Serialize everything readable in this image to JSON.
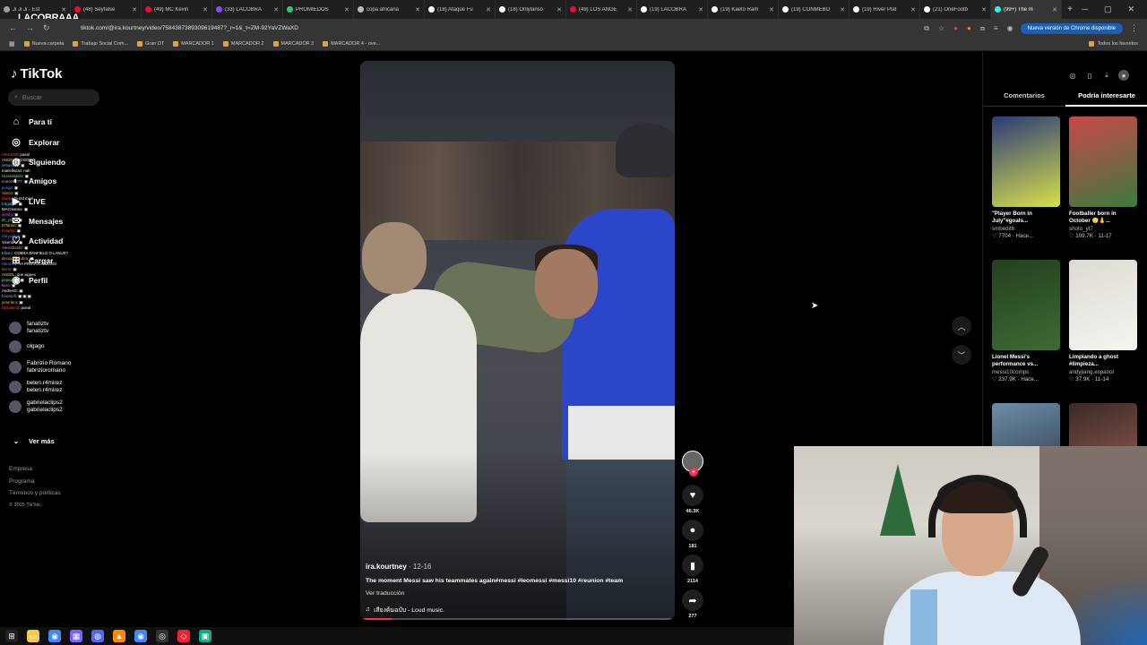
{
  "browser": {
    "overlay_logo": "LACOBRAAA",
    "tabs": [
      {
        "label": "Ji Ji Ji - Est",
        "color": "#9aa0a6",
        "active": false
      },
      {
        "label": "(48) Seyfalse",
        "color": "#ff0033",
        "active": false
      },
      {
        "label": "(49) MC Kevin",
        "color": "#ff0033",
        "active": false
      },
      {
        "label": "(33) LACOBRA",
        "color": "#9146ff",
        "active": false
      },
      {
        "label": "PROMIEDOS",
        "color": "#2ecc71",
        "active": false
      },
      {
        "label": "copa africana",
        "color": "#bbbbbb",
        "active": false
      },
      {
        "label": "(18) Ataque Fu",
        "color": "#ffffff",
        "active": false
      },
      {
        "label": "(18) Onlylanso",
        "color": "#ffffff",
        "active": false
      },
      {
        "label": "(49) LOS ANGE",
        "color": "#ff0033",
        "active": false
      },
      {
        "label": "(19) LACOBRA",
        "color": "#ffffff",
        "active": false
      },
      {
        "label": "(19) Kaeto Ram",
        "color": "#ffffff",
        "active": false
      },
      {
        "label": "(19) CONMEBO",
        "color": "#ffffff",
        "active": false
      },
      {
        "label": "(19) River Plat",
        "color": "#ffffff",
        "active": false
      },
      {
        "label": "(21) OneFootb",
        "color": "#ffffff",
        "active": false
      },
      {
        "label": "(99+) The m",
        "color": "#25f4ee",
        "active": true
      }
    ],
    "url": "tiktok.com/@ira.kourtney/video/7584387389309619487?_r=1&_t=ZM-92YaVZWaXD",
    "update_button": "Nueva versión de Chrome disponible",
    "bookmarks": [
      "Nueva carpeta",
      "Trabajo Social Com...",
      "Gran DT",
      "MARCADOR 1",
      "MARCADOR 2",
      "MARCADOR 3",
      "MARCADOR 4 - ove..."
    ],
    "bookmarks_right": "Todos los favoritos"
  },
  "sidebar": {
    "logo": "TikTok",
    "search_placeholder": "Buscar",
    "nav": [
      {
        "label": "Para ti",
        "icon": "home-icon"
      },
      {
        "label": "Explorar",
        "icon": "compass-icon"
      },
      {
        "label": "Siguiendo",
        "icon": "following-icon"
      },
      {
        "label": "Amigos",
        "icon": "friends-icon"
      },
      {
        "label": "LIVE",
        "icon": "live-icon"
      },
      {
        "label": "Mensajes",
        "icon": "message-icon"
      },
      {
        "label": "Actividad",
        "icon": "activity-icon"
      },
      {
        "label": "Cargar",
        "icon": "upload-icon"
      },
      {
        "label": "Perfil",
        "icon": "profile-icon"
      }
    ],
    "following": [
      {
        "name": "fanatiztv",
        "handle": "fanatiztv"
      },
      {
        "name": "olgago",
        "handle": ""
      },
      {
        "name": "Fabrizio Romano",
        "handle": "fabrizioromano"
      },
      {
        "name": "belen.r4mirez",
        "handle": "belen.r4mirez"
      },
      {
        "name": "gabrielaclips2",
        "handle": "gabrielaclips2"
      }
    ],
    "more": "Ver más",
    "footer": [
      "Empresa",
      "Programa",
      "Términos y políticas",
      "© 2025 TikTok"
    ]
  },
  "chat": [
    {
      "user": "Alexrei08",
      "color": "#ff4d4d",
      "msg": "poeal"
    },
    {
      "user": "ANGEL",
      "color": "#ffd24d",
      "msg": "OOOOOO"
    },
    {
      "user": "seba4881",
      "color": "#4dd2ff",
      "msg": "▣"
    },
    {
      "user": "mariellozan",
      "color": "#ffffff",
      "msg": "nah"
    },
    {
      "user": "Ucieinsiders",
      "color": "#4dff88",
      "msg": "▣"
    },
    {
      "user": "marcelo777",
      "color": "#ff80ff",
      "msg": "▣"
    },
    {
      "user": "poliga",
      "color": "#4d88ff",
      "msg": "▣"
    },
    {
      "user": "Yanco",
      "color": "#ffb84d",
      "msg": "▣"
    },
    {
      "user": "Dantu",
      "color": "#ff4d4d",
      "msg": "blurrd meel"
    },
    {
      "user": "Edgardo",
      "color": "#4dd2ff",
      "msg": "▣"
    },
    {
      "user": "MACmanso",
      "color": "#ffffff",
      "msg": "▣"
    },
    {
      "user": "elenfo",
      "color": "#ff4dff",
      "msg": "▣"
    },
    {
      "user": "itz_yslcx",
      "color": "#4dff88",
      "msg": "▣"
    },
    {
      "user": "ElTanoo",
      "color": "#ffd24d",
      "msg": "▣"
    },
    {
      "user": "hmartin",
      "color": "#ff4d4d",
      "msg": "▣"
    },
    {
      "user": "Stayoutlos",
      "color": "#4d88ff",
      "msg": "▣"
    },
    {
      "user": "Vicenteo",
      "color": "#ffffff",
      "msg": "▣"
    },
    {
      "user": "AlexisSant1",
      "color": "#ff80ff",
      "msg": "▣"
    },
    {
      "user": "Eliseo",
      "color": "#4dd2ff",
      "msg": "COBRA BANFIELD O LANUS?"
    },
    {
      "user": "deciodelacobra",
      "color": "#ffb84d",
      "msg": "▣"
    },
    {
      "user": "AbrunKv",
      "color": "#4d88ff",
      "msg": "YA PROVOCA MESSI"
    },
    {
      "user": "Bone",
      "color": "#ff4d4d",
      "msg": "▣"
    },
    {
      "user": "ANGEL",
      "color": "#ffd24d",
      "msg": "que sigues"
    },
    {
      "user": "pepeparo",
      "color": "#4dff88",
      "msg": "▣"
    },
    {
      "user": "hero",
      "color": "#ff80ff",
      "msg": "▣"
    },
    {
      "user": "AndresG",
      "color": "#ffffff",
      "msg": "▣"
    },
    {
      "user": "fonzicofi",
      "color": "#4dd2ff",
      "msg": "▣ ▣ ▣"
    },
    {
      "user": "peteribru",
      "color": "#ffb84d",
      "msg": "▣"
    },
    {
      "user": "DjGalerza",
      "color": "#ff4d4d",
      "msg": "poeal"
    }
  ],
  "video": {
    "author": "ira.kourtney",
    "date": "12-16",
    "caption": "The moment Messi saw his teammates again#messi #leomessi #messi10 #reunion #team",
    "translate": "Ver traducción",
    "music": "เสียงต้นฉบับ - Loud music.",
    "progress": 0.1,
    "likes": "46.3K",
    "comments": "181",
    "saves": "2114",
    "shares": "277"
  },
  "right_panel": {
    "tabs": [
      "Comentarios",
      "Podría interesarte"
    ],
    "active_tab": 1,
    "cards": [
      {
        "title": "\"Player Born in July\"#goals...",
        "user": "smbedit6",
        "stats": "♡ 7704 · Hace...",
        "c1": "#2b3a78",
        "c2": "#d8e04a"
      },
      {
        "title": "Footballer born in October 😳👃...",
        "user": "shoto_yt7",
        "stats": "♡ 109.7K · 11-17",
        "c1": "#c84848",
        "c2": "#3d7a3d"
      },
      {
        "title": "Lionel Messi's performance vs...",
        "user": "messi10comps",
        "stats": "♡ 237.9K · Hace...",
        "c1": "#23401f",
        "c2": "#3e6a34"
      },
      {
        "title": "Limpiando a ghost #limpieza...",
        "user": "andyjiang.espanol",
        "stats": "♡ 37.9K · 11-14",
        "c1": "#dddad2",
        "c2": "#f6f5f1"
      },
      {
        "title": "",
        "user": "",
        "stats": "",
        "c1": "#6a8ea8",
        "c2": "#2a3240"
      },
      {
        "title": "",
        "user": "",
        "stats": "",
        "c1": "#3a2a2a",
        "c2": "#a06050"
      }
    ]
  },
  "taskbar": [
    "windows-icon",
    "files-icon",
    "chrome-icon",
    "app-icon",
    "discord-icon",
    "vlc-icon",
    "chrome2-icon",
    "obs-icon",
    "app2-icon",
    "app3-icon"
  ]
}
